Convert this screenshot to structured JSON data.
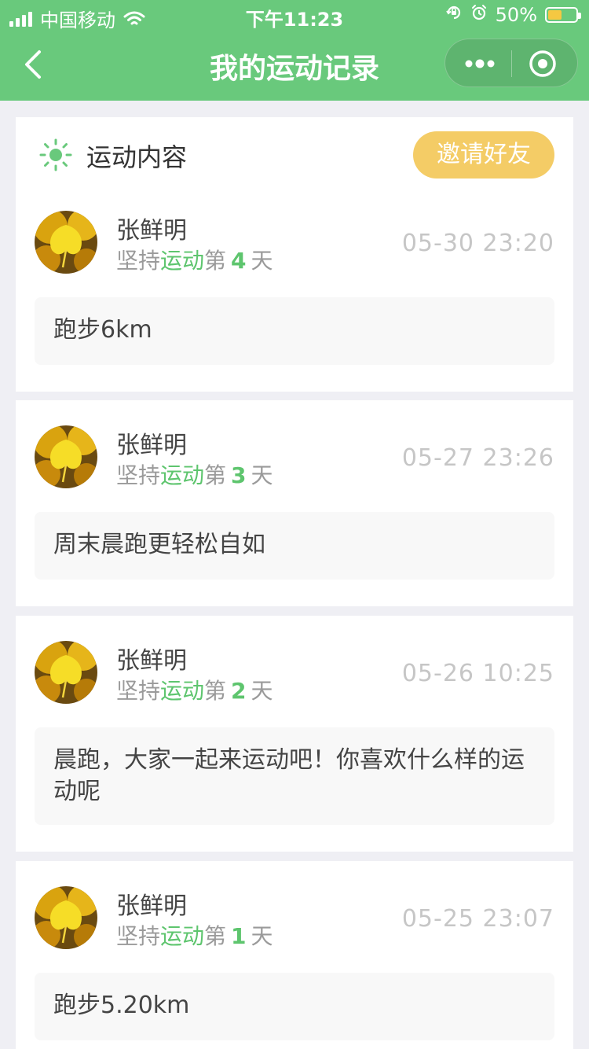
{
  "status_bar": {
    "carrier": "中国移动",
    "time": "下午11:23",
    "battery": "50%",
    "battery_level": 0.5,
    "icons": [
      "signal-icon",
      "wifi-icon",
      "orientation-lock-icon",
      "alarm-icon",
      "battery-icon"
    ]
  },
  "navbar": {
    "title": "我的运动记录",
    "icons": [
      "back-icon",
      "more-icon",
      "close-target-icon"
    ]
  },
  "header": {
    "label": "运动内容",
    "invite_label": "邀请好友",
    "icon": "sun-icon"
  },
  "colors": {
    "brand": "#69c97c",
    "accent": "#f4cc66",
    "highlight": "#5ec56e"
  },
  "records": [
    {
      "name": "张鲜明",
      "persist_prefix": "坚持",
      "persist_sport": "运动",
      "persist_mid": "第",
      "day": "4",
      "persist_suffix": "天",
      "time": "05-30 23:20",
      "content": "跑步6km"
    },
    {
      "name": "张鲜明",
      "persist_prefix": "坚持",
      "persist_sport": "运动",
      "persist_mid": "第",
      "day": "3",
      "persist_suffix": "天",
      "time": "05-27 23:26",
      "content": "周末晨跑更轻松自如"
    },
    {
      "name": "张鲜明",
      "persist_prefix": "坚持",
      "persist_sport": "运动",
      "persist_mid": "第",
      "day": "2",
      "persist_suffix": "天",
      "time": "05-26 10:25",
      "content": "晨跑，大家一起来运动吧！你喜欢什么样的运动呢"
    },
    {
      "name": "张鲜明",
      "persist_prefix": "坚持",
      "persist_sport": "运动",
      "persist_mid": "第",
      "day": "1",
      "persist_suffix": "天",
      "time": "05-25 23:07",
      "content": "跑步5.20km"
    }
  ]
}
